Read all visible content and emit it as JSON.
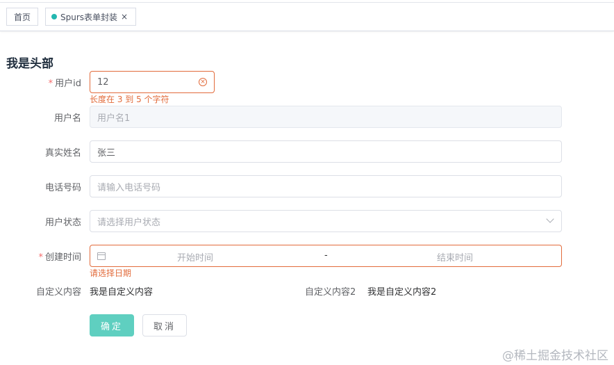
{
  "tabs": [
    {
      "label": "首页"
    },
    {
      "label": "Spurs表单封装",
      "close": "×"
    }
  ],
  "form": {
    "title": "我是头部",
    "user_id": {
      "label": "用户id",
      "value": "12",
      "error": "长度在 3 到 5 个字符"
    },
    "username": {
      "label": "用户名",
      "placeholder": "用户名1"
    },
    "real_name": {
      "label": "真实姓名",
      "value": "张三"
    },
    "phone": {
      "label": "电话号码",
      "placeholder": "请输入电话号码"
    },
    "status": {
      "label": "用户状态",
      "placeholder": "请选择用户状态"
    },
    "created": {
      "label": "创建时间",
      "start_placeholder": "开始时间",
      "separator": "-",
      "end_placeholder": "结束时间",
      "error": "请选择日期"
    },
    "custom1": {
      "label": "自定义内容",
      "value": "我是自定义内容"
    },
    "custom2": {
      "label": "自定义内容2",
      "value": "我是自定义内容2"
    },
    "required_mark": "*",
    "confirm": "确定",
    "cancel": "取消"
  },
  "watermark": "@稀土掘金技术社区"
}
